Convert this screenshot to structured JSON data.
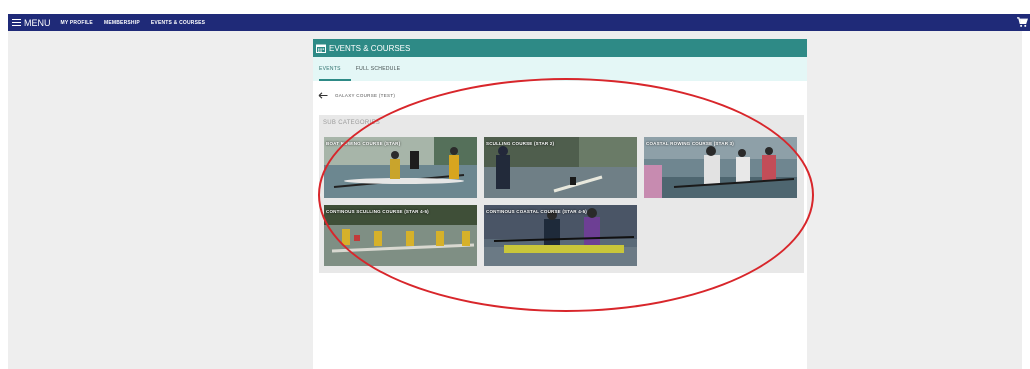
{
  "nav": {
    "menu_label": "MENU",
    "links": [
      "MY PROFILE",
      "MEMBERSHIP",
      "EVENTS & COURSES"
    ]
  },
  "panel": {
    "title": "EVENTS & COURSES",
    "tabs": [
      "EVENTS",
      "FULL SCHEDULE"
    ],
    "active_tab": "EVENTS",
    "breadcrumb": "GALAXY COURSE (TEST)",
    "subcategories_title": "SUB CATEGORIES",
    "cards": [
      {
        "label": "BOAT ROWING COURSE (STAR)"
      },
      {
        "label": "SCULLING COURSE (STAR 2)"
      },
      {
        "label": "COASTAL ROWING COURSE (STAR 3)"
      },
      {
        "label": "CONTINOUS SCULLING COURSE (STAR 4-5)"
      },
      {
        "label": "CONTINOUS COASTAL COURSE (STAR 4-5)"
      }
    ]
  },
  "colors": {
    "navbar": "#1f2a78",
    "panel_header": "#2e8a86",
    "tabs_bg": "#e4f7f6",
    "annotation": "#d8262b"
  },
  "icons": [
    "hamburger-icon",
    "cart-icon",
    "calendar-icon",
    "back-arrow-icon"
  ]
}
